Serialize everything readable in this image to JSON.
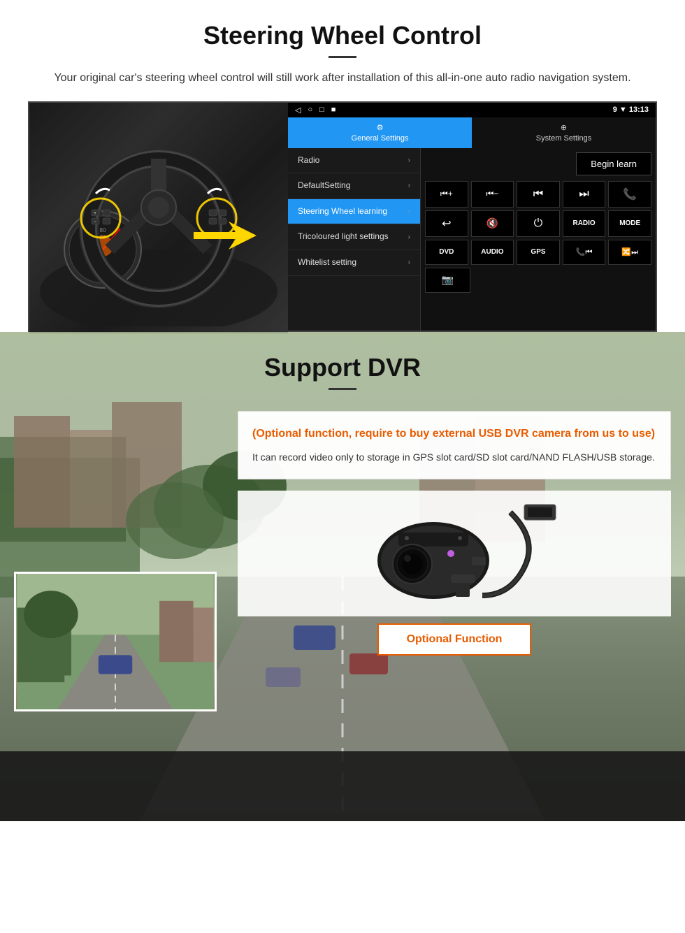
{
  "page": {
    "steering_section": {
      "title": "Steering Wheel Control",
      "description": "Your original car's steering wheel control will still work after installation of this all-in-one auto radio navigation system.",
      "android_ui": {
        "status_bar": {
          "nav_icons": [
            "◁",
            "○",
            "□",
            "■"
          ],
          "signal": "9 ▼",
          "time": "13:13"
        },
        "tabs": [
          {
            "label": "General Settings",
            "active": true
          },
          {
            "label": "System Settings",
            "active": false
          }
        ],
        "menu_items": [
          {
            "label": "Radio",
            "active": false
          },
          {
            "label": "DefaultSetting",
            "active": false
          },
          {
            "label": "Steering Wheel learning",
            "active": true
          },
          {
            "label": "Tricoloured light settings",
            "active": false
          },
          {
            "label": "Whitelist setting",
            "active": false
          }
        ],
        "begin_learn_label": "Begin learn",
        "control_buttons_row1": [
          {
            "symbol": "⏮+",
            "label": ""
          },
          {
            "symbol": "⏮-",
            "label": ""
          },
          {
            "symbol": "⏮",
            "label": ""
          },
          {
            "symbol": "⏭",
            "label": ""
          },
          {
            "symbol": "📞",
            "label": ""
          }
        ],
        "control_buttons_row2": [
          {
            "symbol": "↩",
            "label": ""
          },
          {
            "symbol": "🔇",
            "label": ""
          },
          {
            "symbol": "⏻",
            "label": ""
          },
          {
            "symbol": "RADIO",
            "label": ""
          },
          {
            "symbol": "MODE",
            "label": ""
          }
        ],
        "control_buttons_row3": [
          {
            "symbol": "DVD",
            "label": ""
          },
          {
            "symbol": "AUDIO",
            "label": ""
          },
          {
            "symbol": "GPS",
            "label": ""
          },
          {
            "symbol": "📞⏮",
            "label": ""
          },
          {
            "symbol": "🔀⏭",
            "label": ""
          }
        ],
        "control_buttons_row4": [
          {
            "symbol": "📷",
            "label": ""
          }
        ]
      }
    },
    "dvr_section": {
      "title": "Support DVR",
      "optional_text": "(Optional function, require to buy external USB DVR camera from us to use)",
      "body_text": "It can record video only to storage in GPS slot card/SD slot card/NAND FLASH/USB storage.",
      "optional_function_label": "Optional Function"
    }
  }
}
